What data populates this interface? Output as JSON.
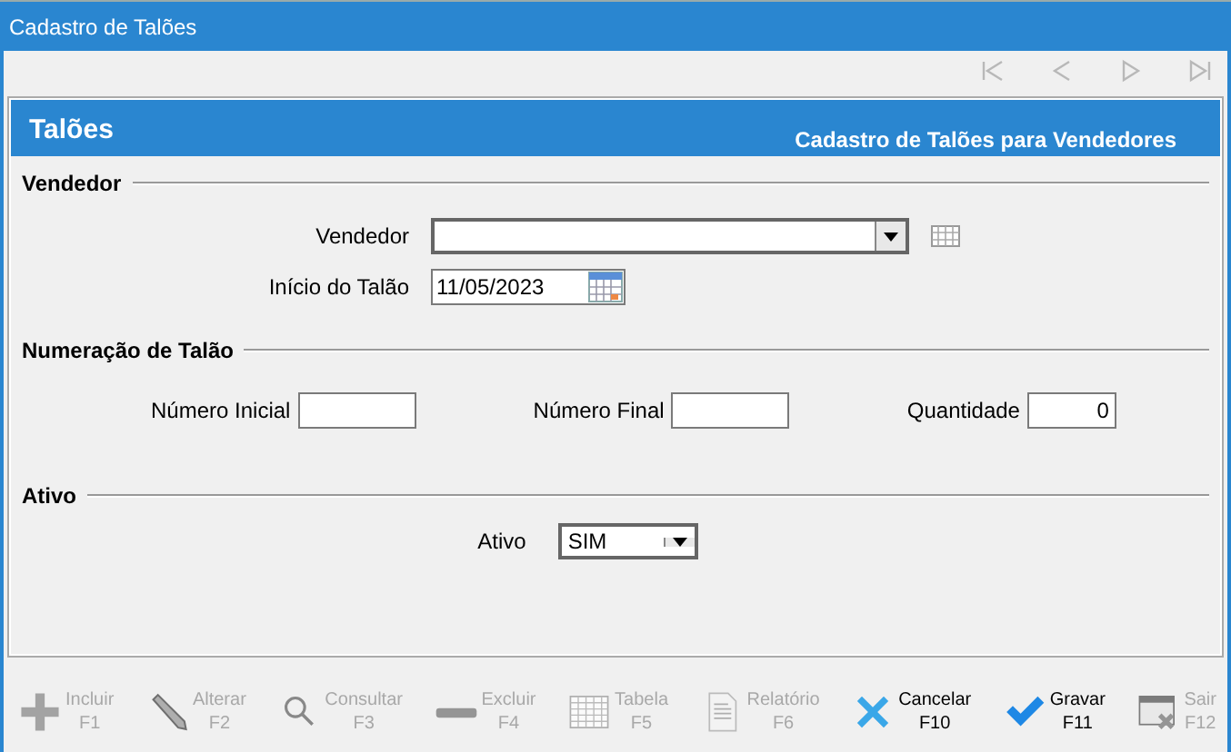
{
  "window": {
    "title": "Cadastro de Talões"
  },
  "navigation": [
    {
      "kind": "first",
      "disabled": true
    },
    {
      "kind": "previous",
      "disabled": true
    },
    {
      "kind": "next",
      "disabled": true
    },
    {
      "kind": "last",
      "disabled": true
    }
  ],
  "panel": {
    "title": "Talões",
    "subtitle": "Cadastro de Talões para Vendedores"
  },
  "sections": [
    {
      "title": "Vendedor",
      "kind": "stacked",
      "fields": [
        {
          "label": "Vendedor",
          "kind": "combo_lookup"
        },
        {
          "label": "Início do Talão",
          "kind": "date",
          "value": "11/05/2023"
        }
      ]
    },
    {
      "title": "Numeração de Talão",
      "kind": "inline",
      "fields": [
        {
          "label": "Número Inicial",
          "kind": "text"
        },
        {
          "label": "Número Final",
          "kind": "text"
        },
        {
          "label": "Quantidade",
          "kind": "number",
          "value": "0"
        }
      ]
    },
    {
      "title": "Ativo",
      "kind": "centered",
      "fields": [
        {
          "label": "Ativo",
          "kind": "select",
          "value": "SIM"
        }
      ]
    }
  ],
  "toolbar": [
    {
      "kind": "plus",
      "label": "Incluir",
      "key": "F1",
      "disabled": true
    },
    {
      "kind": "pencil",
      "label": "Alterar",
      "key": "F2",
      "disabled": true
    },
    {
      "kind": "magnifier",
      "label": "Consultar",
      "key": "F3",
      "disabled": true
    },
    {
      "kind": "minus",
      "label": "Excluir",
      "key": "F4",
      "disabled": true
    },
    {
      "kind": "grid",
      "label": "Tabela",
      "key": "F5",
      "disabled": true
    },
    {
      "kind": "report",
      "label": "Relatório",
      "key": "F6",
      "disabled": true
    },
    {
      "kind": "cross",
      "label": "Cancelar",
      "key": "F10",
      "disabled": false
    },
    {
      "kind": "check",
      "label": "Gravar",
      "key": "F11",
      "disabled": false
    },
    {
      "kind": "exit",
      "label": "Sair",
      "key": "F12",
      "disabled": true
    }
  ]
}
